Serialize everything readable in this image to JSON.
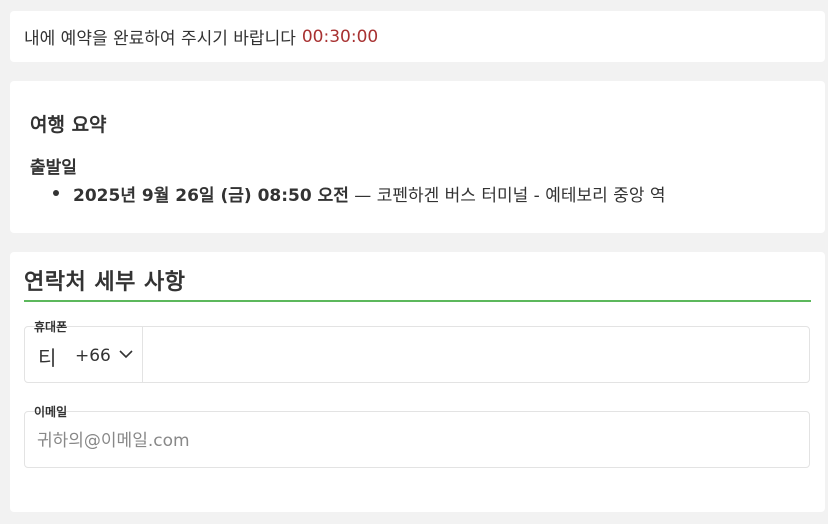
{
  "timer": {
    "message": "내에 예약을 완료하여 주시기 바랍니다",
    "time": "00:30:00",
    "time_color": "#a83232"
  },
  "summary": {
    "title": "여행 요약",
    "departure_label": "출발일",
    "trips": [
      {
        "datetime": "2025년 9월 26일 (금) 08:50 오전",
        "route": "— 코펜하겐 버스 터미널 - 예테보리 중앙 역"
      }
    ]
  },
  "contact": {
    "title": "연락처 세부 사항",
    "accent_color": "#5cb85c",
    "phone": {
      "label": "휴대폰",
      "country_flag": "티",
      "dial_code": "+66",
      "dropdown_icon": "chevron-down-icon",
      "value": ""
    },
    "email": {
      "label": "이메일",
      "placeholder": "귀하의@이메일.com",
      "value": ""
    }
  }
}
